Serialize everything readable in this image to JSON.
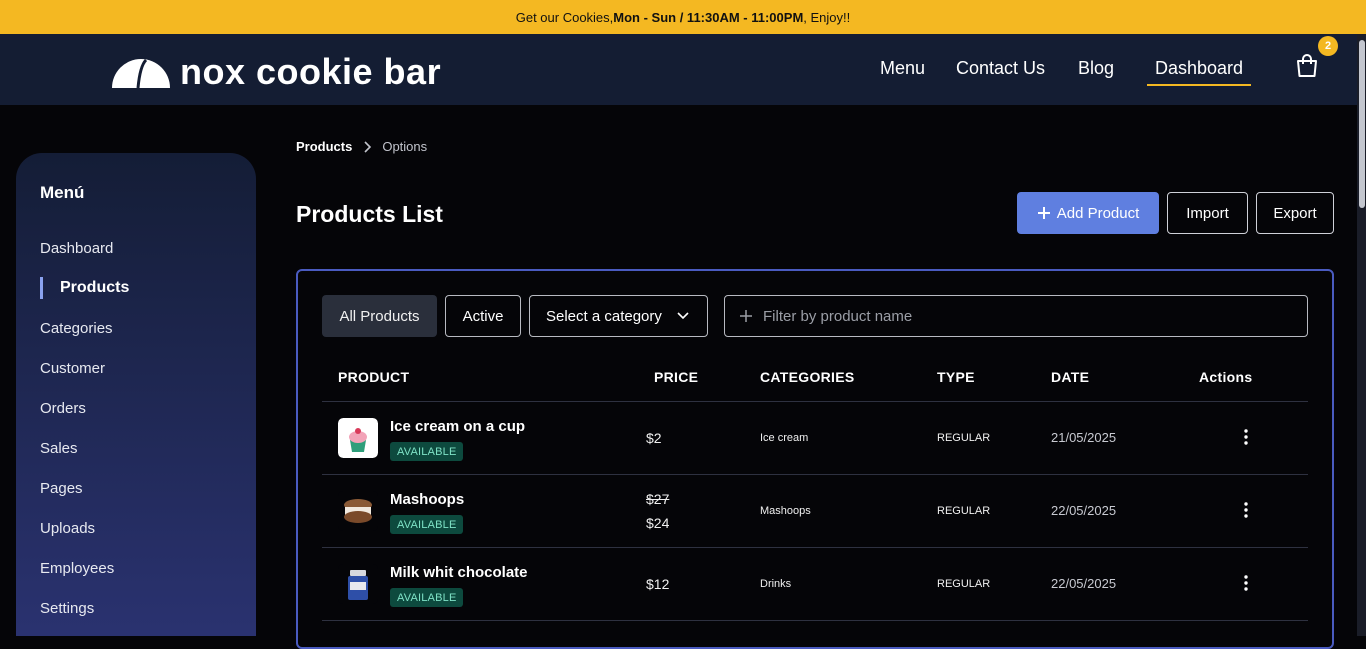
{
  "promo": {
    "prefix": "Get our Cookies, ",
    "hours": "Mon - Sun / 11:30AM - 11:00PM",
    "suffix": ", Enjoy!!"
  },
  "brand": {
    "name": "nox cookie bar"
  },
  "nav": {
    "links": [
      "Menu",
      "Contact Us",
      "Blog",
      "Dashboard"
    ],
    "active": "Dashboard",
    "cart_count": "2"
  },
  "sidebar": {
    "title": "Menú",
    "items": [
      "Dashboard",
      "Products",
      "Categories",
      "Customer",
      "Orders",
      "Sales",
      "Pages",
      "Uploads",
      "Employees",
      "Settings"
    ],
    "active": "Products"
  },
  "breadcrumb": {
    "parent": "Products",
    "current": "Options"
  },
  "page": {
    "title": "Products List"
  },
  "actions": {
    "add": "Add Product",
    "import": "Import",
    "export": "Export"
  },
  "filters": {
    "all": "All Products",
    "active": "Active",
    "category_placeholder": "Select a category",
    "search_placeholder": "Filter by product name"
  },
  "table": {
    "headers": [
      "PRODUCT",
      "PRICE",
      "CATEGORIES",
      "TYPE",
      "DATE",
      "Actions"
    ],
    "rows": [
      {
        "name": "Ice cream on a cup",
        "status": "AVAILABLE",
        "old_price": "",
        "price": "$2",
        "category": "Ice cream",
        "type": "REGULAR",
        "date": "21/05/2025"
      },
      {
        "name": "Mashoops",
        "status": "AVAILABLE",
        "old_price": "$27",
        "price": "$24",
        "category": "Mashoops",
        "type": "REGULAR",
        "date": "22/05/2025"
      },
      {
        "name": "Milk whit chocolate",
        "status": "AVAILABLE",
        "old_price": "",
        "price": "$12",
        "category": "Drinks",
        "type": "REGULAR",
        "date": "22/05/2025"
      }
    ]
  },
  "colors": {
    "promo_bg": "#f4b822",
    "nav_bg": "#141d33",
    "accent": "#5f7fe0",
    "badge_bg": "#0d4a3e",
    "badge_text": "#7fe3c7"
  },
  "icons": [
    "logo-half-circle-icon",
    "cart-icon",
    "chevron-right-icon",
    "plus-icon",
    "chevron-down-icon",
    "kebab-menu-icon"
  ]
}
